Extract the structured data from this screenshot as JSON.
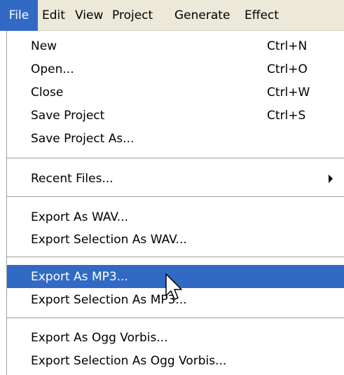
{
  "menubar": {
    "items": [
      {
        "label": "File"
      },
      {
        "label": "Edit"
      },
      {
        "label": "View"
      },
      {
        "label": "Project"
      },
      {
        "label": "Generate"
      },
      {
        "label": "Effect"
      }
    ]
  },
  "file_menu": {
    "new": {
      "label": "New",
      "shortcut": "Ctrl+N"
    },
    "open": {
      "label": "Open...",
      "shortcut": "Ctrl+O"
    },
    "close": {
      "label": "Close",
      "shortcut": "Ctrl+W"
    },
    "save_project": {
      "label": "Save Project",
      "shortcut": "Ctrl+S"
    },
    "save_project_as": {
      "label": "Save Project As..."
    },
    "recent_files": {
      "label": "Recent Files..."
    },
    "export_wav": {
      "label": "Export As WAV..."
    },
    "export_selection_wav": {
      "label": "Export Selection As WAV..."
    },
    "export_mp3": {
      "label": "Export As MP3..."
    },
    "export_selection_mp3": {
      "label": "Export Selection As MP3..."
    },
    "export_ogg": {
      "label": "Export As Ogg Vorbis..."
    },
    "export_selection_ogg": {
      "label": "Export Selection As Ogg Vorbis..."
    }
  },
  "colors": {
    "highlight": "#316ac5",
    "menubar_bg": "#ece9d8",
    "menu_bg": "#ffffff",
    "separator": "#a0a0a0"
  },
  "icons": {
    "cursor": "mouse-pointer-icon",
    "submenu": "submenu-arrow-icon"
  }
}
